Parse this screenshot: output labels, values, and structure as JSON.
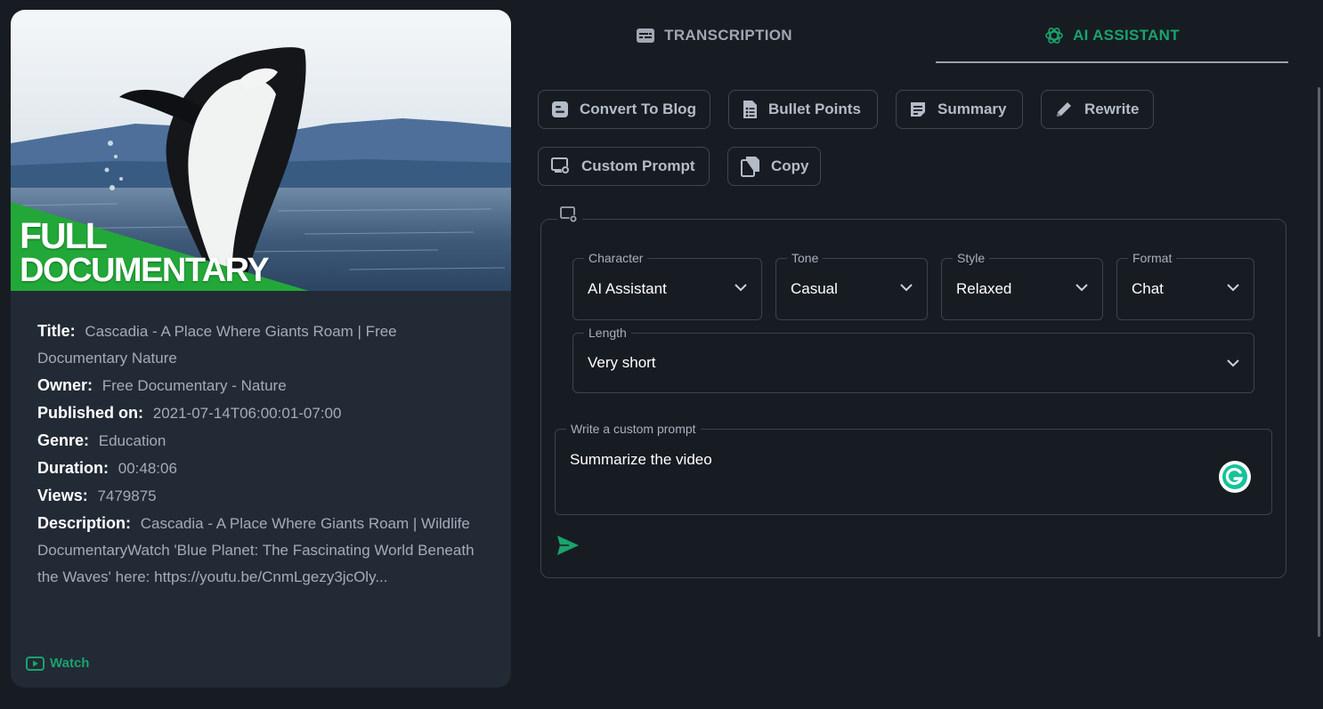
{
  "video": {
    "thumbnail_text_line1": "FULL",
    "thumbnail_text_line2": "DOCUMENTARY",
    "fields": [
      {
        "key": "Title:",
        "value": "Cascadia - A Place Where Giants Roam | Free Documentary Nature"
      },
      {
        "key": "Owner:",
        "value": "Free Documentary - Nature"
      },
      {
        "key": "Published on:",
        "value": "2021-07-14T06:00:01-07:00"
      },
      {
        "key": "Genre:",
        "value": "Education"
      },
      {
        "key": "Duration:",
        "value": "00:48:06"
      },
      {
        "key": "Views:",
        "value": "7479875"
      },
      {
        "key": "Description:",
        "value": "Cascadia - A Place Where Giants Roam | Wildlife DocumentaryWatch 'Blue Planet: The Fascinating World Beneath the Waves' here: https://youtu.be/CnmLgezy3jcOly..."
      }
    ],
    "watch_label": "Watch"
  },
  "tabs": [
    {
      "label": "TRANSCRIPTION",
      "icon": "subtitles-icon",
      "active": false
    },
    {
      "label": "AI ASSISTANT",
      "icon": "openai-icon",
      "active": true
    }
  ],
  "actions": {
    "convert_to_blog": "Convert To Blog",
    "bullet_points": "Bullet Points",
    "summary": "Summary",
    "rewrite": "Rewrite",
    "custom_prompt": "Custom Prompt",
    "copy": "Copy"
  },
  "settings": {
    "character": {
      "label": "Character",
      "value": "AI Assistant"
    },
    "tone": {
      "label": "Tone",
      "value": "Casual"
    },
    "style": {
      "label": "Style",
      "value": "Relaxed"
    },
    "format": {
      "label": "Format",
      "value": "Chat"
    },
    "length": {
      "label": "Length",
      "value": "Very short"
    }
  },
  "prompt": {
    "label": "Write a custom prompt",
    "value": "Summarize the video"
  },
  "colors": {
    "accent": "#1aa36b",
    "background": "#171c23",
    "card": "#222a35",
    "border": "#3b434e"
  }
}
